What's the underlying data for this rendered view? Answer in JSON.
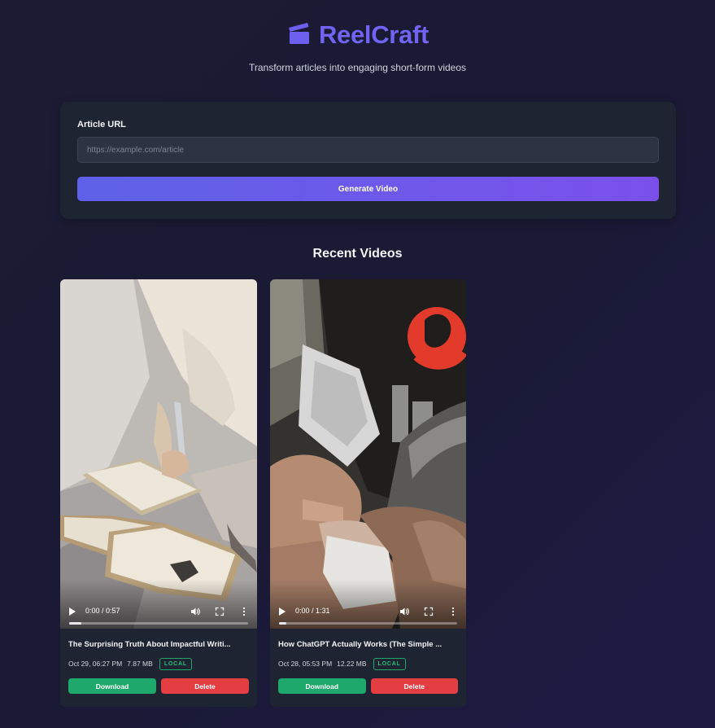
{
  "app": {
    "name": "ReelCraft",
    "tagline": "Transform articles into engaging short-form videos"
  },
  "form": {
    "label": "Article URL",
    "placeholder": "https://example.com/article",
    "value": "",
    "submit_label": "Generate Video"
  },
  "recent": {
    "title": "Recent Videos",
    "videos": [
      {
        "title": "The Surprising Truth About Impactful Writi...",
        "time": "0:00 / 0:57",
        "progress": 0.07,
        "date": "Oct 29, 06:27 PM",
        "size": "7.87 MB",
        "badge": "LOCAL",
        "download_label": "Download",
        "delete_label": "Delete"
      },
      {
        "title": "How ChatGPT Actually Works (The Simple ...",
        "time": "0:00 / 1:31",
        "progress": 0.04,
        "date": "Oct 28, 05:53 PM",
        "size": "12.22 MB",
        "badge": "LOCAL",
        "download_label": "Download",
        "delete_label": "Delete"
      }
    ]
  },
  "colors": {
    "brand": "#7064f0",
    "background": "#1b1b33",
    "card": "#1f2433",
    "download": "#1ea86b",
    "delete": "#e43d42",
    "badge": "#22c37a"
  }
}
